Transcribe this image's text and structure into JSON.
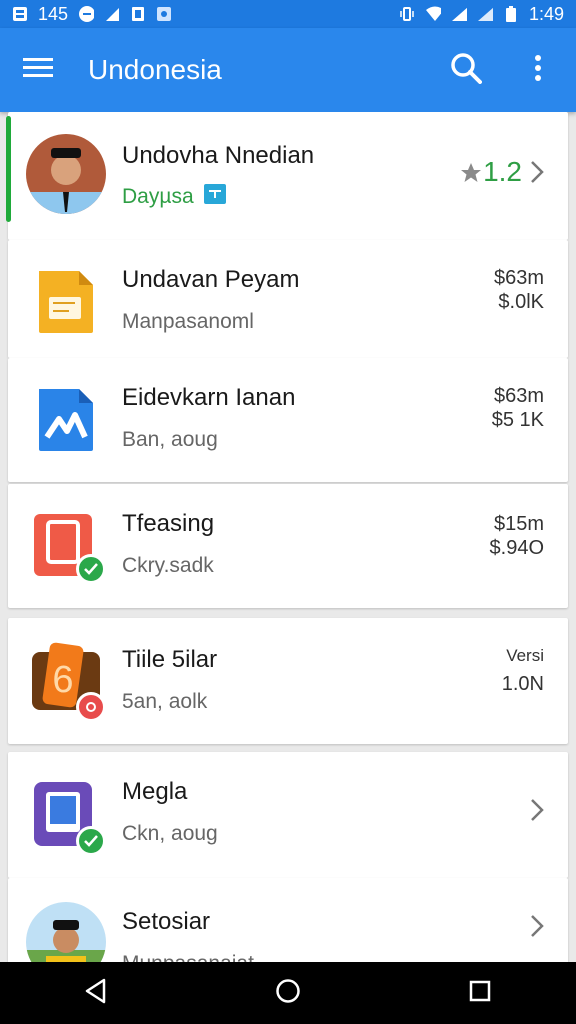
{
  "status_bar": {
    "left_text": "145",
    "time": "1:49"
  },
  "app_bar": {
    "title": "Undonesia"
  },
  "items": [
    {
      "title": "Undovha Nnedian",
      "subtitle": "Dayµsa",
      "rating": "1.2"
    },
    {
      "title": "Undavan Peyam",
      "subtitle": "Manpasanoml",
      "price_line1": "$63m",
      "price_line2": "$.0lK"
    },
    {
      "title": "Eidevkarn Ianan",
      "subtitle": "Ban, aoug",
      "price_line1": "$63m",
      "price_line2": "$5 1K"
    },
    {
      "title": "Tfeasing",
      "subtitle": "Ckry.sadk",
      "price_line1": "$15m",
      "price_line2": "$.94O"
    },
    {
      "title": "Tiile 5ilar",
      "subtitle": "5an, aolk",
      "price_line1": "Versi",
      "price_line2": "1.0N",
      "icon_text": "6"
    },
    {
      "title": "Megla",
      "subtitle": "Ckn, aoug"
    },
    {
      "title": "Setosiar",
      "subtitle": "Munpasanaiat"
    }
  ],
  "colors": {
    "primary": "#2a87ec",
    "status": "#1e7ae0",
    "accent_green": "#1faa3a",
    "star": "#8a8a8a"
  },
  "icons": [
    "menu-icon",
    "search-icon",
    "more-vert-icon",
    "star-icon",
    "chevron-right-icon",
    "back-icon",
    "home-icon",
    "recents-icon"
  ]
}
